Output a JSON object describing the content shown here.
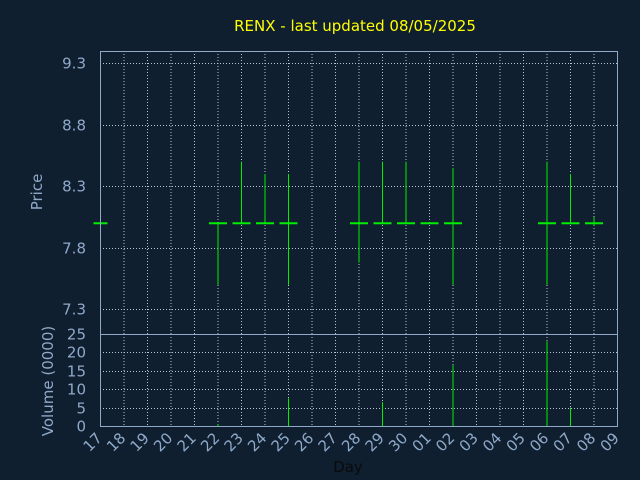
{
  "chart_data": {
    "type": "ohlc",
    "title": "RENX - last updated 08/05/2025",
    "xlabel": "Day",
    "x_tick_labels": [
      "17",
      "18",
      "19",
      "20",
      "21",
      "22",
      "23",
      "24",
      "25",
      "26",
      "27",
      "28",
      "29",
      "30",
      "01",
      "02",
      "03",
      "04",
      "05",
      "06",
      "07",
      "08",
      "09"
    ],
    "price_panel": {
      "ylabel": "Price",
      "ylim": [
        7.1,
        9.4
      ],
      "y_ticks": [
        "9.3",
        "8.8",
        "8.3",
        "7.8",
        "7.3"
      ],
      "grid": true,
      "bars": [
        {
          "day_index": 0,
          "open": 8.0,
          "high": 8.0,
          "low": 8.0,
          "close": 8.0
        },
        {
          "day_index": 5,
          "open": 8.0,
          "high": 8.0,
          "low": 7.5,
          "close": 8.0
        },
        {
          "day_index": 6,
          "open": 8.0,
          "high": 8.5,
          "low": 8.0,
          "close": 8.0
        },
        {
          "day_index": 7,
          "open": 8.0,
          "high": 8.4,
          "low": 8.0,
          "close": 8.0
        },
        {
          "day_index": 8,
          "open": 8.0,
          "high": 8.4,
          "low": 7.5,
          "close": 8.0
        },
        {
          "day_index": 11,
          "open": 8.0,
          "high": 8.5,
          "low": 7.68,
          "close": 8.0
        },
        {
          "day_index": 12,
          "open": 8.0,
          "high": 8.5,
          "low": 8.0,
          "close": 8.0
        },
        {
          "day_index": 13,
          "open": 8.0,
          "high": 8.5,
          "low": 8.0,
          "close": 8.0
        },
        {
          "day_index": 14,
          "open": 8.0,
          "high": 8.0,
          "low": 8.0,
          "close": 8.0
        },
        {
          "day_index": 15,
          "open": 8.0,
          "high": 8.45,
          "low": 7.5,
          "close": 8.0
        },
        {
          "day_index": 19,
          "open": 8.0,
          "high": 8.5,
          "low": 7.5,
          "close": 8.0
        },
        {
          "day_index": 20,
          "open": 8.0,
          "high": 8.4,
          "low": 8.0,
          "close": 8.0
        },
        {
          "day_index": 21,
          "open": 8.0,
          "high": 8.05,
          "low": 7.98,
          "close": 8.0
        }
      ]
    },
    "volume_panel": {
      "ylabel": "Volume (0000)",
      "ylim": [
        0,
        25
      ],
      "y_ticks": [
        "25",
        "20",
        "15",
        "10",
        "5",
        "0"
      ],
      "grid": true,
      "bars": [
        {
          "day_index": 5,
          "value": 0.5
        },
        {
          "day_index": 8,
          "value": 7.5
        },
        {
          "day_index": 12,
          "value": 6.5
        },
        {
          "day_index": 15,
          "value": 16.5
        },
        {
          "day_index": 19,
          "value": 23
        },
        {
          "day_index": 20,
          "value": 5
        }
      ]
    },
    "colors": {
      "background": "#0f1f30",
      "title": "#ffff00",
      "axis_text": "#8fa9c8",
      "grid": "#b8c4d0",
      "frame": "#8fa9c8",
      "bars": "#00ee00"
    }
  }
}
